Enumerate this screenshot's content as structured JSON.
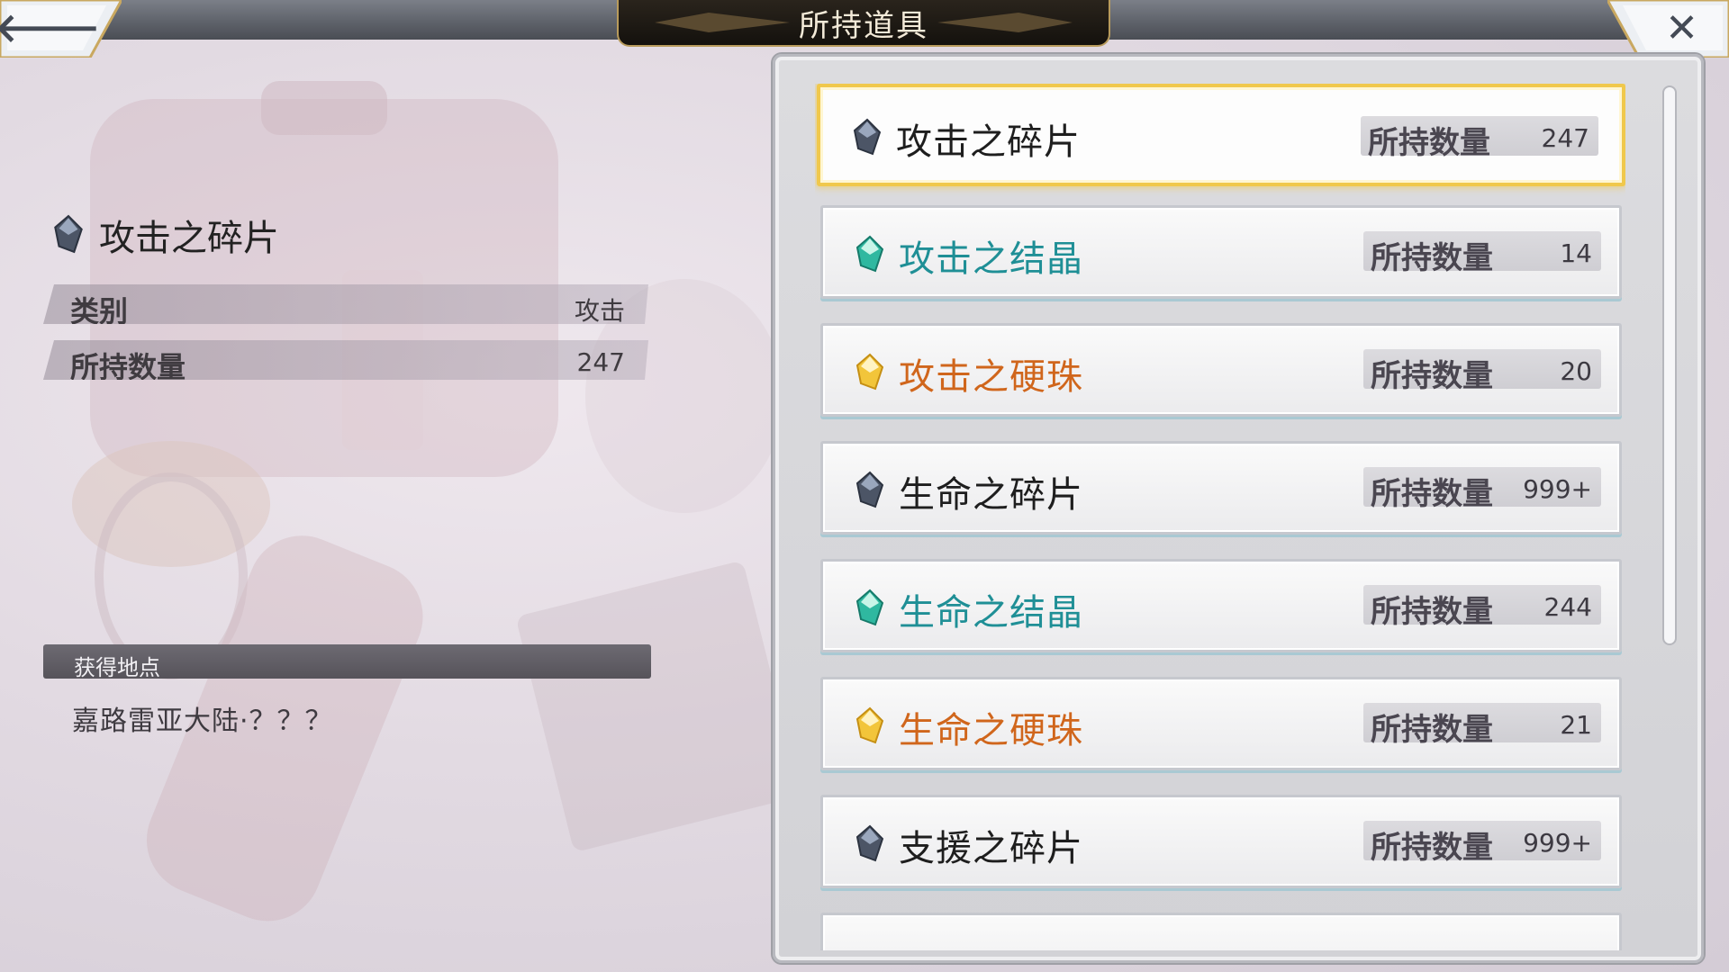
{
  "header": {
    "title": "所持道具"
  },
  "nav": {
    "back_glyph": "🡐",
    "close_glyph": "✕"
  },
  "detail": {
    "item_name": "攻击之碎片",
    "icon": "gem-shard-icon",
    "rows": [
      {
        "label": "类别",
        "value": "攻击"
      },
      {
        "label": "所持数量",
        "value": "247"
      }
    ],
    "obtain_label": "获得地点",
    "obtain_location": "嘉路雷亚大陆·？？？"
  },
  "list": {
    "count_label": "所持数量",
    "items": [
      {
        "name": "攻击之碎片",
        "count": "247",
        "color": "#1e1e1e",
        "gem": "shard",
        "selected": true
      },
      {
        "name": "攻击之结晶",
        "count": "14",
        "color": "#1f8f96",
        "gem": "crystal"
      },
      {
        "name": "攻击之硬珠",
        "count": "20",
        "color": "#d0661c",
        "gem": "orb"
      },
      {
        "name": "生命之碎片",
        "count": "999+",
        "color": "#1e1e1e",
        "gem": "shard"
      },
      {
        "name": "生命之结晶",
        "count": "244",
        "color": "#1f8f96",
        "gem": "crystal"
      },
      {
        "name": "生命之硬珠",
        "count": "21",
        "color": "#d0661c",
        "gem": "orb"
      },
      {
        "name": "支援之碎片",
        "count": "999+",
        "color": "#1e1e1e",
        "gem": "shard"
      }
    ]
  },
  "colors": {
    "selected_border": "#f0c84c",
    "crystal": "#1f8f96",
    "orb": "#d0661c"
  }
}
